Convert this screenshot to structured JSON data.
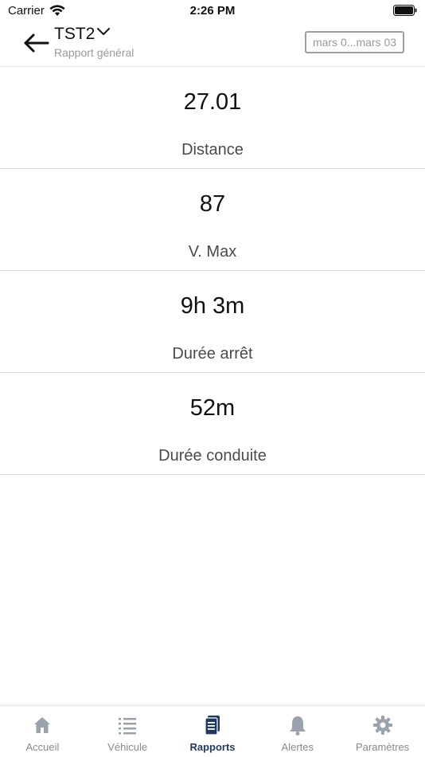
{
  "status_bar": {
    "carrier": "Carrier",
    "time": "2:26 PM"
  },
  "header": {
    "title": "TST2",
    "subtitle": "Rapport général",
    "date_range": "mars 0...mars 03"
  },
  "stats": [
    {
      "value": "27.01",
      "label": "Distance"
    },
    {
      "value": "87",
      "label": "V. Max"
    },
    {
      "value": "9h 3m",
      "label": "Durée arrêt"
    },
    {
      "value": "52m",
      "label": "Durée conduite"
    }
  ],
  "tab_bar": {
    "tabs": [
      {
        "label": "Accueil",
        "icon": "home-icon"
      },
      {
        "label": "Véhicule",
        "icon": "list-icon"
      },
      {
        "label": "Rapports",
        "icon": "report-icon"
      },
      {
        "label": "Alertes",
        "icon": "bell-icon"
      },
      {
        "label": "Paramètres",
        "icon": "gear-icon"
      }
    ],
    "active_index": 2
  },
  "colors": {
    "active_tab": "#1f3a5f",
    "inactive_tab": "#8a8a8a",
    "icon_inactive": "#9aa3ad"
  }
}
